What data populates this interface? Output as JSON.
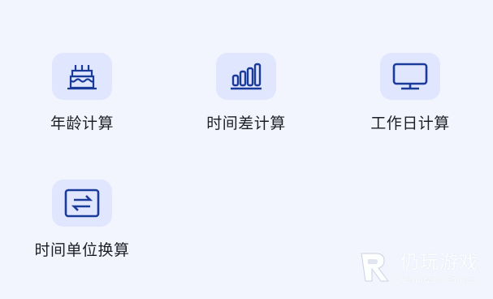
{
  "top_row_labels": [
    "",
    "",
    ""
  ],
  "tiles": [
    {
      "label": "年龄计算",
      "icon": "cake-icon"
    },
    {
      "label": "时间差计算",
      "icon": "bar-chart-icon"
    },
    {
      "label": "工作日计算",
      "icon": "monitor-icon"
    },
    {
      "label": "时间单位换算",
      "icon": "swap-arrows-icon"
    }
  ],
  "watermark": {
    "cn": "仍玩游戏",
    "en": "Rengwan Games"
  },
  "colors": {
    "accent": "#1a3b9a",
    "icon_bg": "#dfe6fd",
    "background": "#f3f5fe"
  }
}
